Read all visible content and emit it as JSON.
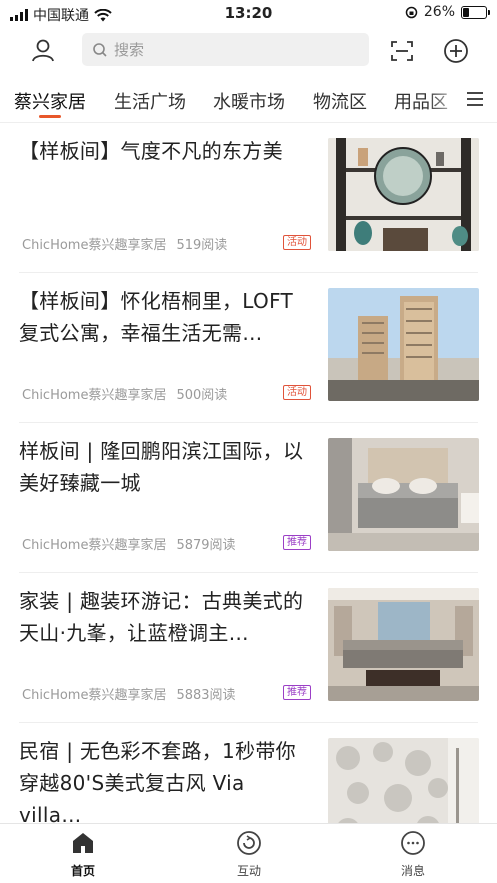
{
  "status": {
    "carrier": "中国联通",
    "time": "13:20",
    "battery": "26%"
  },
  "search": {
    "placeholder": "搜索"
  },
  "tabs": [
    {
      "label": "蔡兴家居",
      "active": true
    },
    {
      "label": "生活广场",
      "active": false
    },
    {
      "label": "水暖市场",
      "active": false
    },
    {
      "label": "物流区",
      "active": false
    },
    {
      "label": "用品区",
      "active": false
    }
  ],
  "articles": [
    {
      "title": "【样板间】气度不凡的东方美",
      "source": "ChicHome蔡兴趣享家居",
      "reads": "519阅读",
      "badge": "活动"
    },
    {
      "title": "【样板间】怀化梧桐里，LOFT复式公寓，幸福生活无需…",
      "source": "ChicHome蔡兴趣享家居",
      "reads": "500阅读",
      "badge": "活动"
    },
    {
      "title": "样板间 | 隆回鹏阳滨江国际，以美好臻藏一城",
      "source": "ChicHome蔡兴趣享家居",
      "reads": "5879阅读",
      "badge": "推荐"
    },
    {
      "title": "家装 | 趣装环游记：古典美式的天山·九峯，让蓝橙调主…",
      "source": "ChicHome蔡兴趣享家居",
      "reads": "5883阅读",
      "badge": "推荐"
    },
    {
      "title": "民宿 | 无色彩不套路，1秒带你穿越80'S美式复古风 Via villa…",
      "source": "",
      "reads": "",
      "badge": ""
    }
  ],
  "nav": [
    {
      "label": "首页",
      "icon": "home-icon",
      "active": true
    },
    {
      "label": "互动",
      "icon": "interact-icon",
      "active": false
    },
    {
      "label": "消息",
      "icon": "message-icon",
      "active": false
    }
  ],
  "colors": {
    "accent": "#e8572a",
    "badge_hot": "#e0533a",
    "badge_rec": "#9b3fc6"
  }
}
